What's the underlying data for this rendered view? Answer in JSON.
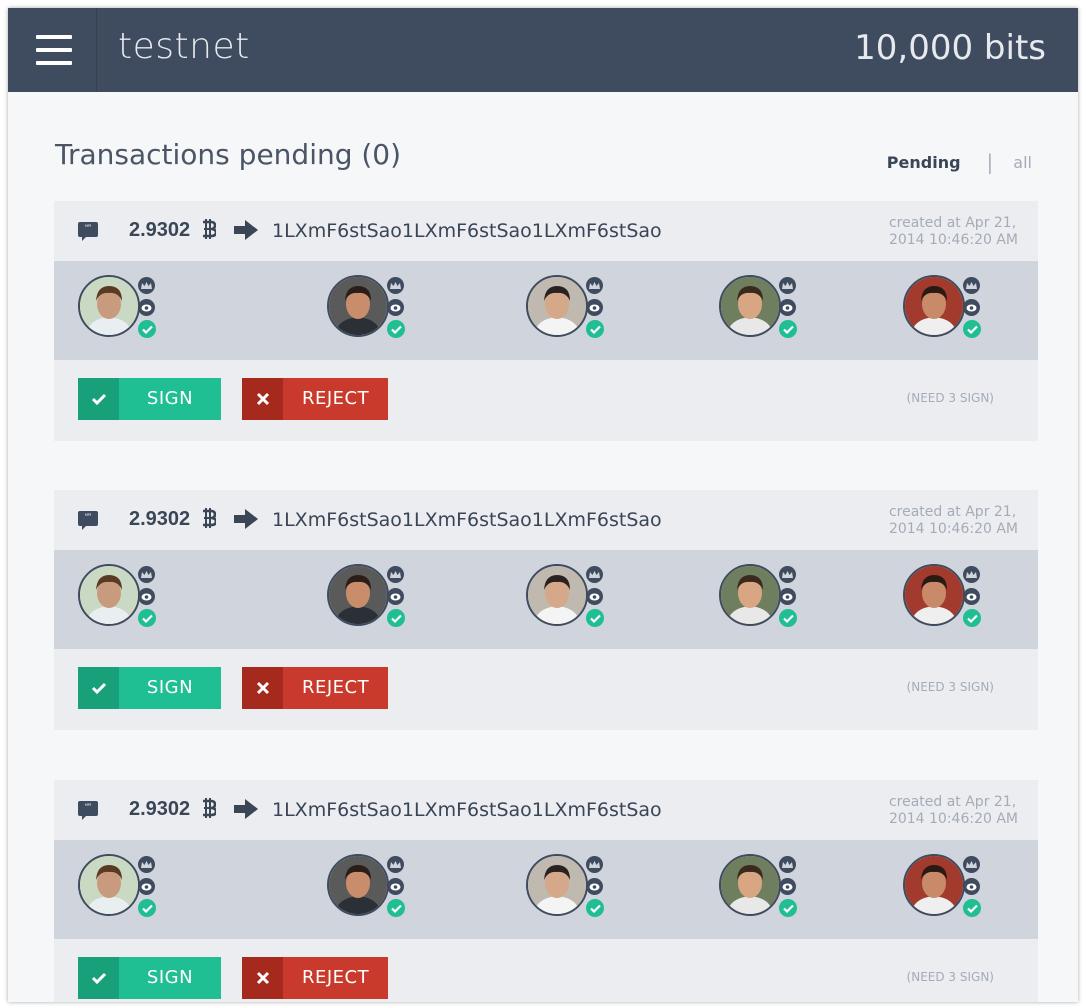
{
  "app": {
    "network": "testnet",
    "balance": "10,000 bits"
  },
  "page": {
    "title": "Transactions pending (0)",
    "filter": {
      "pending": "Pending",
      "separator": "|",
      "all": "all"
    }
  },
  "transactions": [
    {
      "amount": "2.9302",
      "address": "1LXmF6stSao1LXmF6stSao1LXmF6stSao",
      "created_line1": "created at Apr 21,",
      "created_line2": "2014 10:46:20 AM",
      "sign_label": "SIGN",
      "reject_label": "REJECT",
      "need": "(NEED 3 SIGN)"
    },
    {
      "amount": "2.9302",
      "address": "1LXmF6stSao1LXmF6stSao1LXmF6stSao",
      "created_line1": "created at Apr 21,",
      "created_line2": "2014 10:46:20 AM",
      "sign_label": "SIGN",
      "reject_label": "REJECT",
      "need": "(NEED 3 SIGN)"
    },
    {
      "amount": "2.9302",
      "address": "1LXmF6stSao1LXmF6stSao1LXmF6stSao",
      "created_line1": "created at Apr 21,",
      "created_line2": "2014 10:46:20 AM",
      "sign_label": "SIGN",
      "reject_label": "REJECT",
      "need": "(NEED 3 SIGN)"
    }
  ],
  "signer_icons": [
    "crown-icon",
    "eye-icon",
    "check-icon"
  ],
  "colors": {
    "topbar": "#3f4b5e",
    "sign": "#1fbf93",
    "sign_dark": "#18a07b",
    "reject": "#c93a2c",
    "reject_dark": "#a6291d",
    "signed_check": "#1fbf93"
  }
}
